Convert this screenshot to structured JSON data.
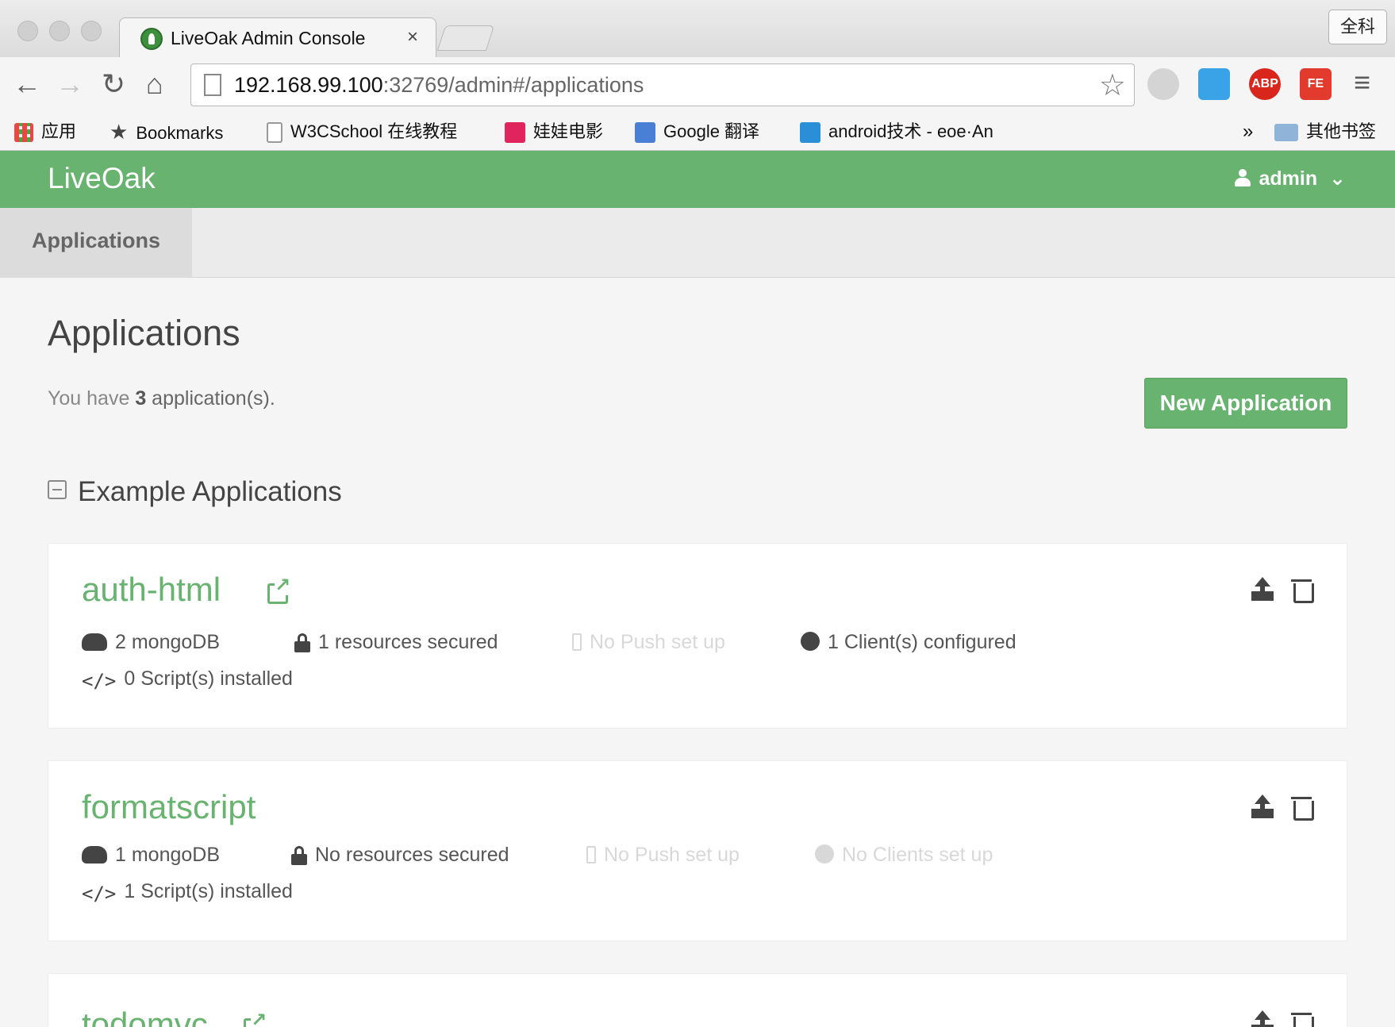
{
  "browser": {
    "tab_title": "LiveOak Admin Console",
    "tab_close": "×",
    "profile_label": "全科",
    "url_host": "192.168.99.100",
    "url_rest": ":32769/admin#/applications",
    "nav": {
      "back": "←",
      "forward": "→",
      "reload": "↻",
      "home": "⌂",
      "star": "☆",
      "menu": "≡"
    },
    "extensions": [
      {
        "label": "",
        "color": "#bfbfbf"
      },
      {
        "label": "",
        "color": "#3aa3e8"
      },
      {
        "label": "ABP",
        "color": "#d9261c"
      },
      {
        "label": "FE",
        "color": "#e23b2e"
      }
    ],
    "bookmarks": [
      {
        "label": "应用"
      },
      {
        "label": "Bookmarks"
      },
      {
        "label": "W3CSchool 在线教程"
      },
      {
        "label": "娃娃电影"
      },
      {
        "label": "Google 翻译"
      },
      {
        "label": "android技术 - eoe·An"
      }
    ],
    "bookmarks_overflow": "»",
    "other_bookmarks": "其他书签"
  },
  "app": {
    "brand": "LiveOak",
    "user": "admin",
    "user_caret": "⌄",
    "subnav_tab": "Applications",
    "page_title": "Applications",
    "count_prefix": "You have",
    "count_value": "3",
    "count_suffix": "application(s).",
    "new_button": "New Application",
    "section_title": "Example Applications"
  },
  "applications": [
    {
      "name": "auth-html",
      "storage": "2 mongoDB",
      "security": "1 resources secured",
      "push": "No Push set up",
      "clients": "1 Client(s) configured",
      "scripts": "0 Script(s) installed"
    },
    {
      "name": "formatscript",
      "storage": "1 mongoDB",
      "security": "No resources secured",
      "push": "No Push set up",
      "clients": "No Clients set up",
      "scripts": "1 Script(s) installed"
    },
    {
      "name": "todomvc"
    }
  ]
}
